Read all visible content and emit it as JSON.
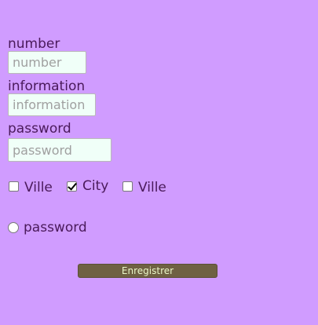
{
  "form": {
    "number_label": "number",
    "number_placeholder": "number",
    "information_label": "information",
    "information_placeholder": "information",
    "password_label": "password",
    "password_placeholder": "password",
    "checkboxes": [
      {
        "label": "Ville",
        "checked": false
      },
      {
        "label": "City",
        "checked": true
      },
      {
        "label": "Ville",
        "checked": false
      }
    ],
    "radio_label": "password",
    "radio_selected": false,
    "submit_label": "Enregistrer"
  },
  "colors": {
    "background": "#d09cff",
    "text": "#4a1a5a",
    "input_background": "#f0fff8",
    "button_background": "#6f6143",
    "button_text": "#eaf7c8"
  }
}
